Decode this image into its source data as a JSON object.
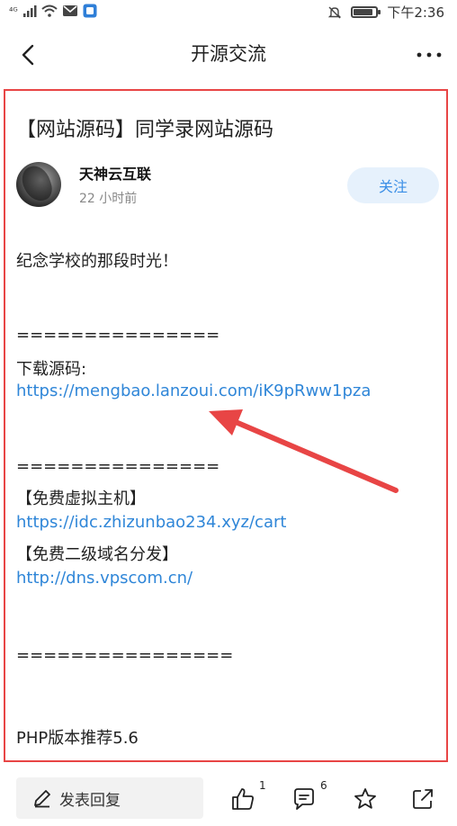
{
  "status_bar": {
    "network": "⁴ᴳ",
    "time": "下午2:36",
    "battery_level": 0.8
  },
  "nav": {
    "title": "开源交流"
  },
  "post": {
    "title": "【网站源码】同学录网站源码",
    "author": "天神云互联",
    "time": "22 小时前",
    "follow_label": "关注",
    "lines": [
      "纪念学校的那段时光！",
      "===============",
      "下载源码:",
      "https://mengbao.lanzoui.com/iK9pRww1pza",
      "===============",
      "【免费虚拟主机】",
      "https://idc.zhizunbao234.xyz/cart",
      "【免费二级域名分发】",
      "http://dns.vpscom.cn/",
      "================",
      "PHP版本推荐5.6"
    ]
  },
  "bottom_bar": {
    "reply_placeholder": "发表回复",
    "like_count": "1",
    "comment_count": "6"
  },
  "colors": {
    "link": "#2f86d8",
    "highlight_frame": "#e84545",
    "follow_bg": "#e6f1fc",
    "follow_text": "#3a8ee6"
  },
  "icons": [
    "back-icon",
    "more-icon",
    "pen-icon",
    "like-icon",
    "comment-icon",
    "star-icon",
    "share-icon",
    "wifi-icon",
    "signal-icon",
    "mail-icon",
    "mute-icon",
    "battery-icon"
  ]
}
